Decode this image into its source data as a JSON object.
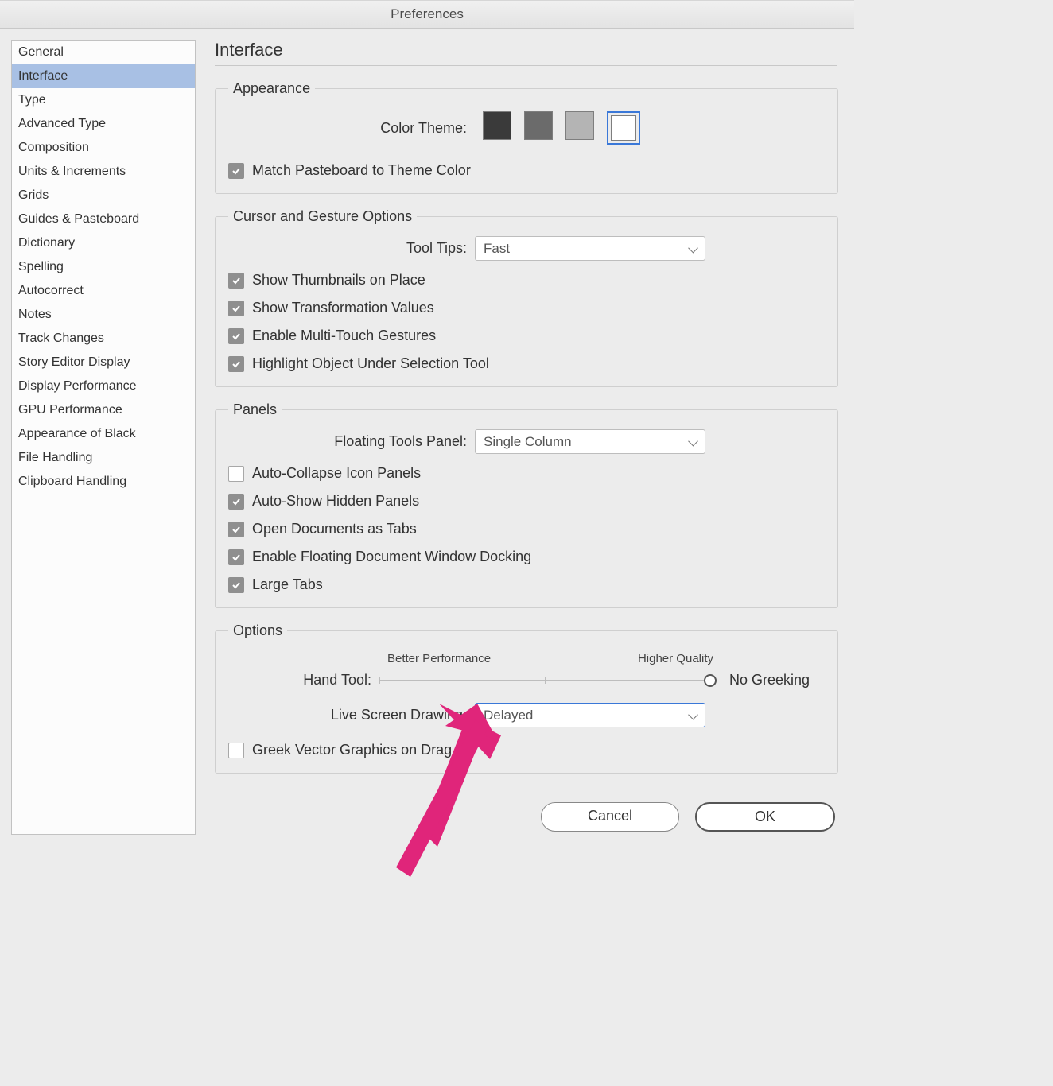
{
  "window": {
    "title": "Preferences"
  },
  "sidebar": {
    "items": [
      "General",
      "Interface",
      "Type",
      "Advanced Type",
      "Composition",
      "Units & Increments",
      "Grids",
      "Guides & Pasteboard",
      "Dictionary",
      "Spelling",
      "Autocorrect",
      "Notes",
      "Track Changes",
      "Story Editor Display",
      "Display Performance",
      "GPU Performance",
      "Appearance of Black",
      "File Handling",
      "Clipboard Handling"
    ],
    "selected_index": 1
  },
  "page": {
    "title": "Interface"
  },
  "appearance": {
    "legend": "Appearance",
    "color_theme_label": "Color Theme:",
    "swatches": [
      {
        "color": "#3a3a3a",
        "selected": false
      },
      {
        "color": "#6b6b6b",
        "selected": false
      },
      {
        "color": "#b4b4b4",
        "selected": false
      },
      {
        "color": "#ffffff",
        "selected": true
      }
    ],
    "match_pasteboard": {
      "checked": true,
      "label": "Match Pasteboard to Theme Color"
    }
  },
  "cursor": {
    "legend": "Cursor and Gesture Options",
    "tool_tips_label": "Tool Tips:",
    "tool_tips_value": "Fast",
    "show_thumbnails": {
      "checked": true,
      "label": "Show Thumbnails on Place"
    },
    "show_transformation": {
      "checked": true,
      "label": "Show Transformation Values"
    },
    "enable_multitouch": {
      "checked": true,
      "label": "Enable Multi-Touch Gestures"
    },
    "highlight_object": {
      "checked": true,
      "label": "Highlight Object Under Selection Tool"
    }
  },
  "panels": {
    "legend": "Panels",
    "floating_tools_label": "Floating Tools Panel:",
    "floating_tools_value": "Single Column",
    "auto_collapse": {
      "checked": false,
      "label": "Auto-Collapse Icon Panels"
    },
    "auto_show_hidden": {
      "checked": true,
      "label": "Auto-Show Hidden Panels"
    },
    "open_as_tabs": {
      "checked": true,
      "label": "Open Documents as Tabs"
    },
    "enable_docking": {
      "checked": true,
      "label": "Enable Floating Document Window Docking"
    },
    "large_tabs": {
      "checked": true,
      "label": "Large Tabs"
    }
  },
  "options": {
    "legend": "Options",
    "better_perf": "Better Performance",
    "higher_quality": "Higher Quality",
    "hand_tool_label": "Hand Tool:",
    "no_greeking": "No Greeking",
    "live_screen_label": "Live Screen Drawing:",
    "live_screen_value": "Delayed",
    "greek_vector": {
      "checked": false,
      "label": "Greek Vector Graphics on Drag"
    }
  },
  "footer": {
    "cancel": "Cancel",
    "ok": "OK"
  },
  "annotation": {
    "arrow_color": "#e0257a"
  }
}
